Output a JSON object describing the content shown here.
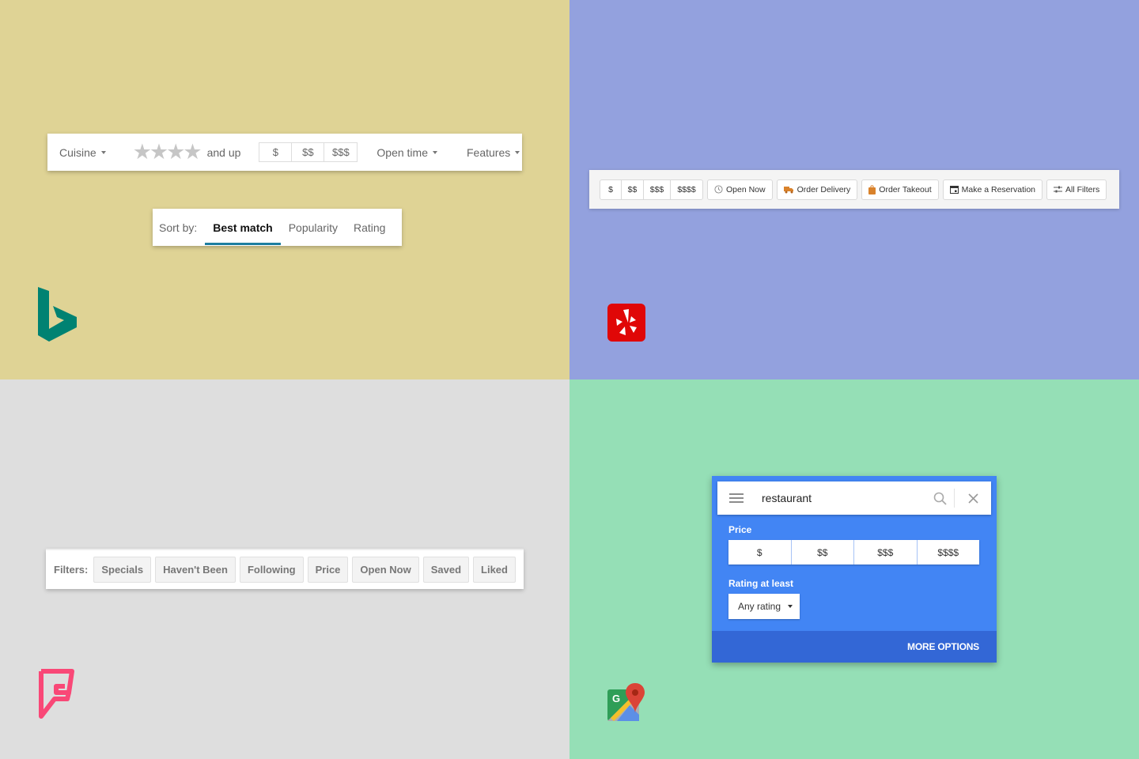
{
  "colors": {
    "bing_bg": "#dfd395",
    "yelp_bg": "#93a1de",
    "foursquare_bg": "#dedede",
    "gmaps_bg": "#95dfb6",
    "bing_accent": "#1d7ea0",
    "bing_logo": "#008272",
    "yelp_logo": "#e00707",
    "foursquare_logo": "#f94877",
    "gmaps_panel": "#4285f4",
    "gmaps_footer": "#3367d6"
  },
  "bing": {
    "filters": {
      "cuisine": "Cuisine",
      "stars_count": 4,
      "and_up": "and up",
      "prices": [
        "$",
        "$$",
        "$$$"
      ],
      "open_time": "Open time",
      "features": "Features"
    },
    "sort": {
      "label": "Sort by:",
      "tabs": [
        "Best match",
        "Popularity",
        "Rating"
      ],
      "active": "Best match"
    }
  },
  "yelp": {
    "prices": [
      "$",
      "$$",
      "$$$",
      "$$$$"
    ],
    "buttons": [
      {
        "label": "Open Now",
        "icon": "clock-icon"
      },
      {
        "label": "Order Delivery",
        "icon": "delivery-truck-icon"
      },
      {
        "label": "Order Takeout",
        "icon": "takeout-bag-icon"
      },
      {
        "label": "Make a Reservation",
        "icon": "calendar-icon"
      },
      {
        "label": "All Filters",
        "icon": "sliders-icon"
      }
    ]
  },
  "foursquare": {
    "label": "Filters:",
    "chips": [
      "Specials",
      "Haven't Been",
      "Following",
      "Price",
      "Open Now",
      "Saved",
      "Liked"
    ]
  },
  "gmaps": {
    "search_value": "restaurant",
    "price_label": "Price",
    "prices": [
      "$",
      "$$",
      "$$$",
      "$$$$"
    ],
    "rating_label": "Rating at least",
    "rating_value": "Any rating",
    "more_options": "MORE OPTIONS"
  }
}
